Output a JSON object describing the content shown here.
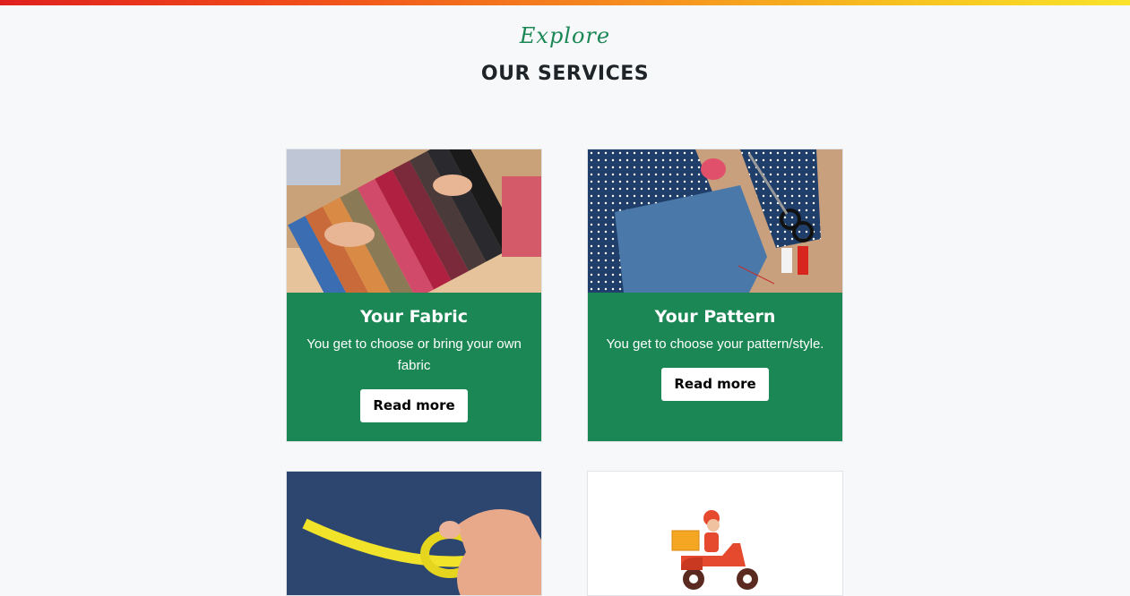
{
  "header": {
    "script_title": "Explore",
    "title": "OUR SERVICES"
  },
  "colors": {
    "brand_green": "#1a8754",
    "top_bar_gradient": [
      "#e0201e",
      "#f58b1f",
      "#fbe32a"
    ]
  },
  "cards": [
    {
      "image": "fabric-swatches-photo",
      "title": "Your Fabric",
      "text": "You get to choose or bring your own fabric",
      "button": "Read more"
    },
    {
      "image": "sewing-pattern-photo",
      "title": "Your Pattern",
      "text": "You get to choose your pattern/style.",
      "button": "Read more"
    },
    {
      "image": "measuring-tape-photo"
    },
    {
      "image": "delivery-scooter-icon"
    }
  ]
}
